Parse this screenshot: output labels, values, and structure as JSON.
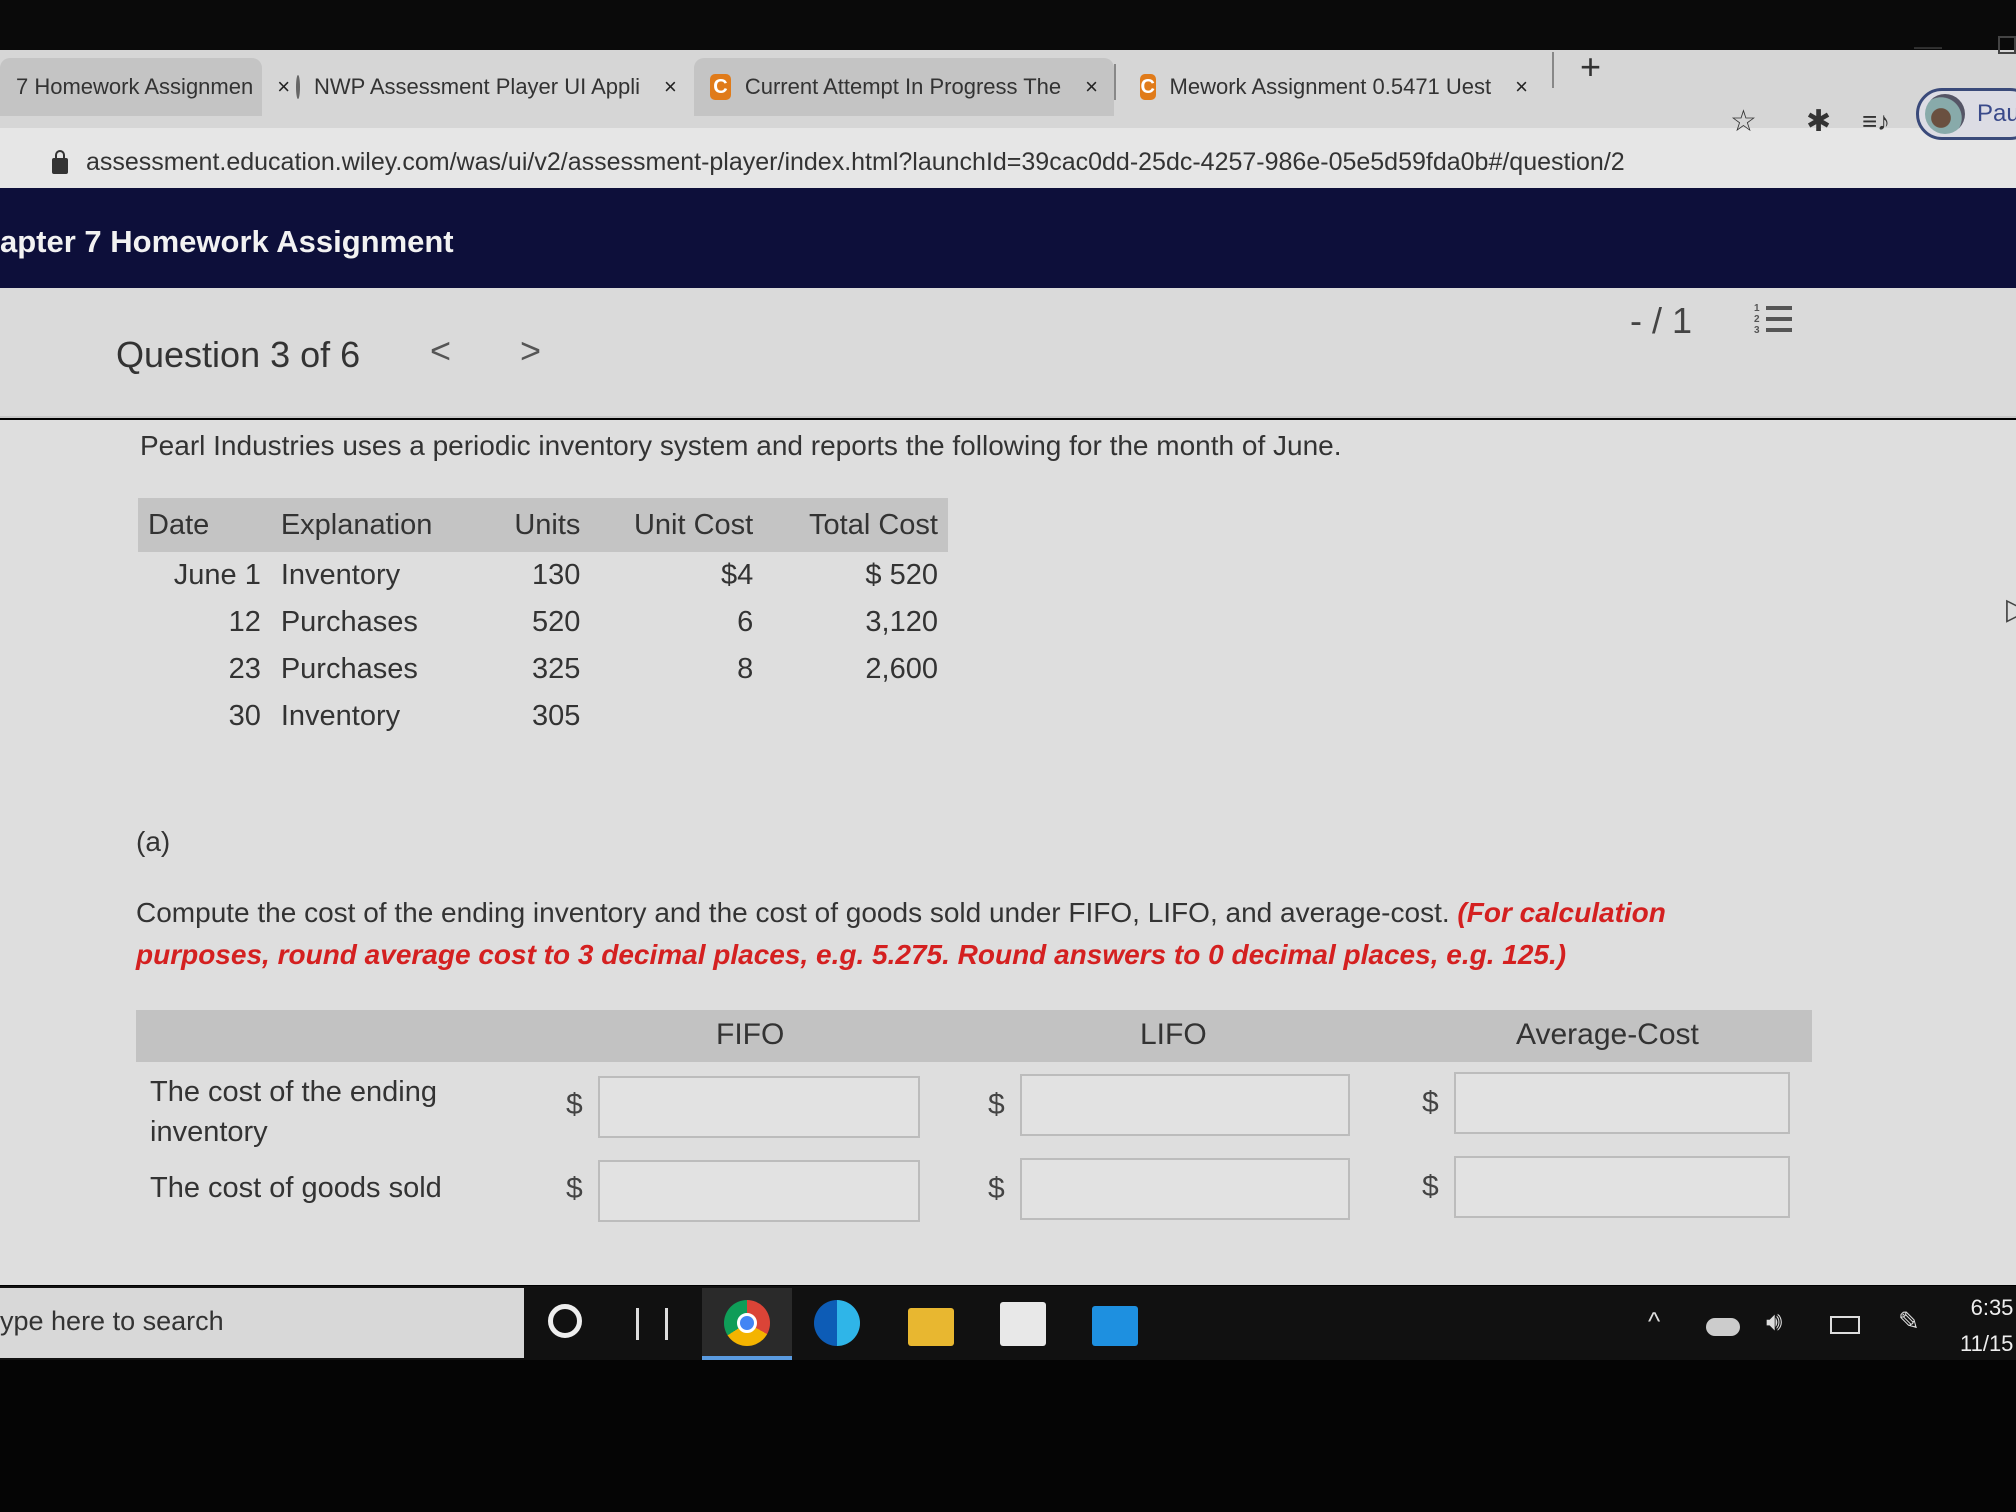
{
  "browser": {
    "tabs": [
      {
        "label": "7 Homework Assignmen",
        "icon": "page-icon",
        "close": "×"
      },
      {
        "label": "NWP Assessment Player UI Appli",
        "icon": "globe-icon",
        "close": "×"
      },
      {
        "label": "Current Attempt In Progress The",
        "icon": "c-logo-icon",
        "icon_text": "C",
        "close": "×"
      },
      {
        "label": "Mework Assignment 0.5471 Uest",
        "icon": "c-logo-icon",
        "icon_text": "C",
        "close": "×"
      }
    ],
    "new_tab": "+",
    "minimize": "—",
    "url": "assessment.education.wiley.com/was/ui/v2/assessment-player/index.html?launchId=39cac0dd-25dc-4257-986e-05e5d59fda0b#/question/2",
    "toolbar_icons": {
      "star": "☆",
      "extensions": "✱",
      "media": "≡♪"
    },
    "profile_label": "Paus"
  },
  "app": {
    "title": "apter 7 Homework Assignment"
  },
  "question_nav": {
    "title": "Question 3 of 6",
    "prev": "<",
    "next": ">",
    "score": "- / 1"
  },
  "question": {
    "intro": "Pearl Industries uses a periodic inventory system and reports the following for the month of June.",
    "table": {
      "headers": [
        "Date",
        "Explanation",
        "Units",
        "Unit Cost",
        "Total Cost"
      ],
      "rows": [
        [
          "June 1",
          "Inventory",
          "130",
          "$4",
          "$ 520"
        ],
        [
          "12",
          "Purchases",
          "520",
          "6",
          "3,120"
        ],
        [
          "23",
          "Purchases",
          "325",
          "8",
          "2,600"
        ],
        [
          "30",
          "Inventory",
          "305",
          "",
          ""
        ]
      ]
    },
    "part_label": "(a)",
    "instruction": "Compute the cost of the ending inventory and the cost of goods sold under FIFO, LIFO, and average-cost.",
    "instruction_note": "(For calculation purposes, round average cost to 3 decimal places, e.g. 5.275. Round answers to 0 decimal places, e.g. 125.)",
    "answer_table": {
      "columns": [
        "FIFO",
        "LIFO",
        "Average-Cost"
      ],
      "currency": "$",
      "rows": [
        {
          "label": "The cost of the ending inventory",
          "values": [
            "",
            "",
            ""
          ]
        },
        {
          "label": "The cost of goods sold",
          "values": [
            "",
            "",
            ""
          ]
        }
      ]
    }
  },
  "taskbar": {
    "search_placeholder": "ype here to search",
    "time": "6:35",
    "date": "11/15"
  }
}
